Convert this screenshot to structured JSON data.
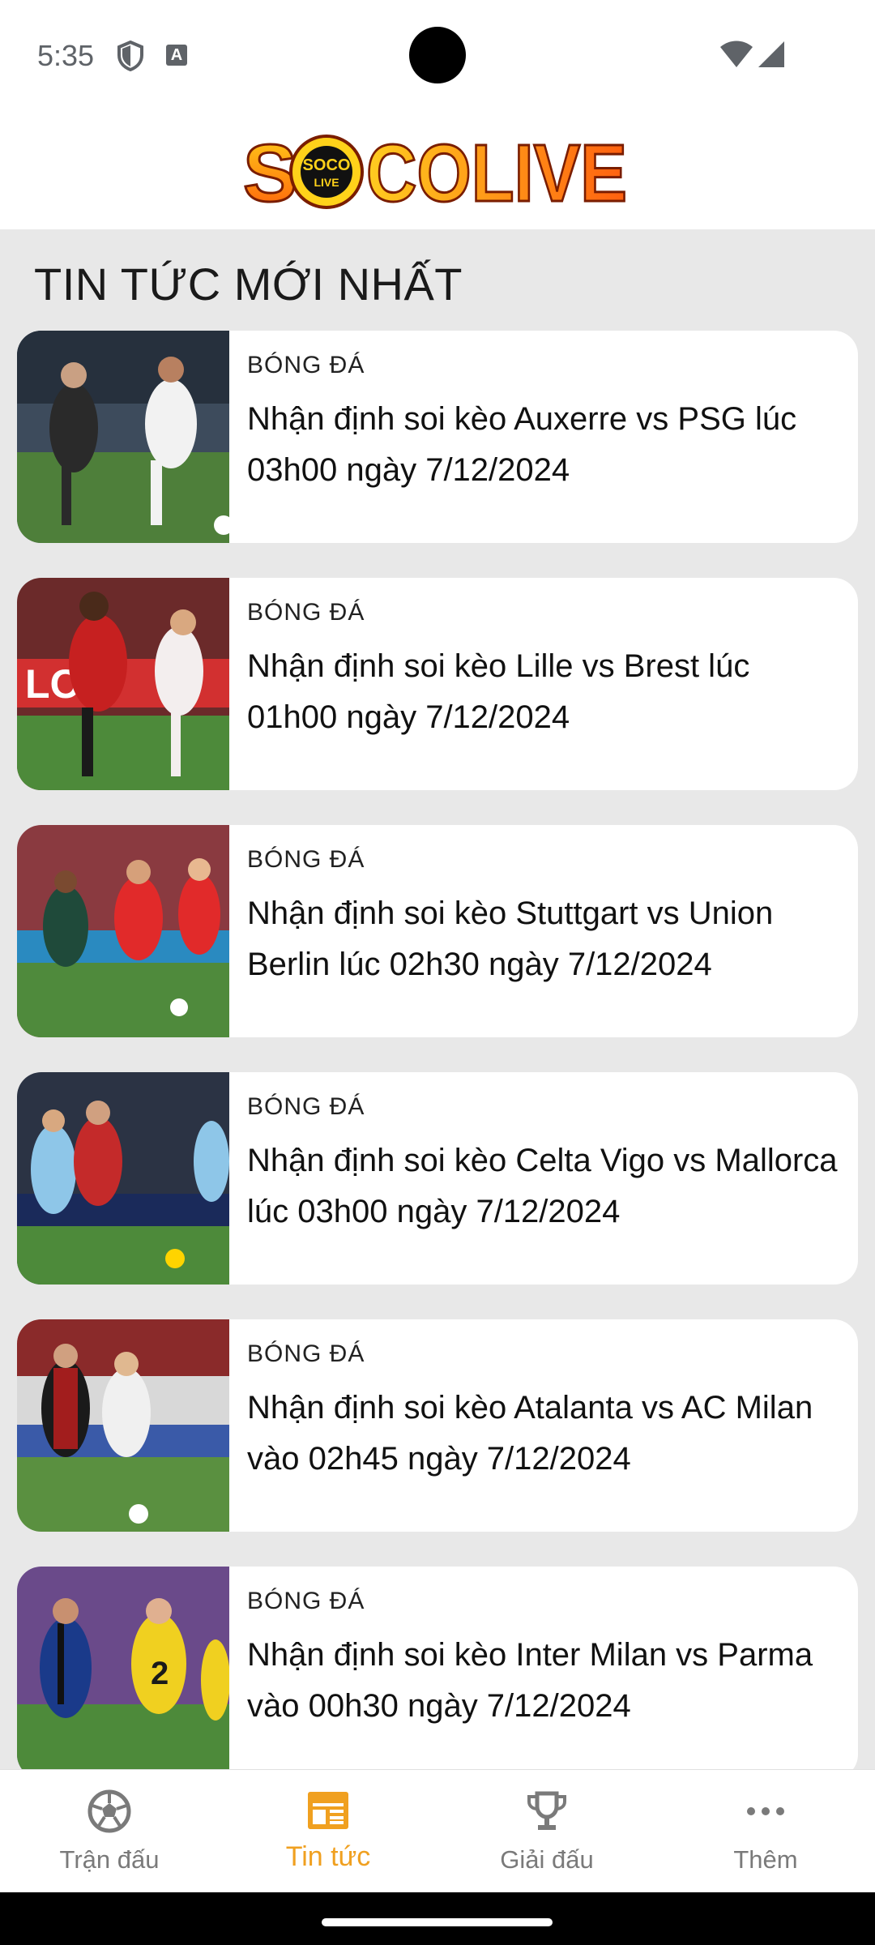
{
  "status": {
    "time": "5:35"
  },
  "brand": {
    "logo_text_left": "S",
    "logo_ball_text": "SOCO LIVE",
    "logo_text_right": "COLIVE"
  },
  "section": {
    "title": "TIN TỨC MỚI NHẤT"
  },
  "news": [
    {
      "category": "BÓNG ĐÁ",
      "title": "Nhận định soi kèo Auxerre vs PSG lúc 03h00 ngày 7/12/2024"
    },
    {
      "category": "BÓNG ĐÁ",
      "title": "Nhận định soi kèo Lille vs Brest lúc 01h00 ngày 7/12/2024"
    },
    {
      "category": "BÓNG ĐÁ",
      "title": "Nhận định soi kèo Stuttgart vs Union Berlin lúc 02h30 ngày 7/12/2024"
    },
    {
      "category": "BÓNG ĐÁ",
      "title": "Nhận định soi kèo Celta Vigo vs Mallorca lúc 03h00 ngày 7/12/2024"
    },
    {
      "category": "BÓNG ĐÁ",
      "title": "Nhận định soi kèo Atalanta vs AC Milan vào 02h45 ngày 7/12/2024"
    },
    {
      "category": "BÓNG ĐÁ",
      "title": "Nhận định soi kèo Inter Milan vs Parma vào 00h30 ngày 7/12/2024"
    }
  ],
  "nav": {
    "items": [
      {
        "label": "Trận đấu",
        "icon": "soccer-ball-icon"
      },
      {
        "label": "Tin tức",
        "icon": "newspaper-icon",
        "active": true
      },
      {
        "label": "Giải đấu",
        "icon": "trophy-icon"
      },
      {
        "label": "Thêm",
        "icon": "more-dots-icon"
      }
    ],
    "active_color": "#f0a020",
    "inactive_color": "#7a7a7a"
  }
}
